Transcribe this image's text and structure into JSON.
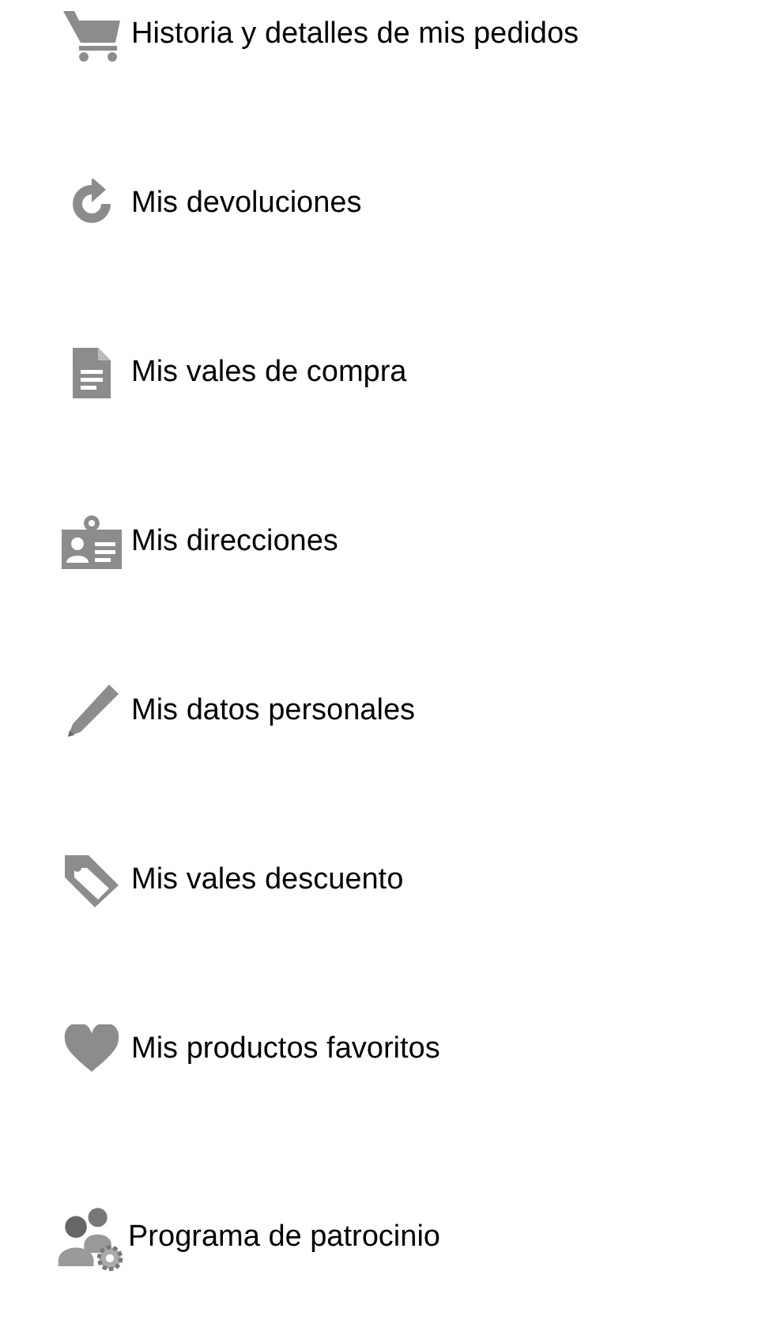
{
  "menu": [
    {
      "kind": "cart",
      "label": "Historia y detalles de mis pedidos"
    },
    {
      "kind": "returns",
      "label": "Mis devoluciones"
    },
    {
      "kind": "document",
      "label": "Mis vales de compra"
    },
    {
      "kind": "badge",
      "label": "Mis direcciones"
    },
    {
      "kind": "pencil",
      "label": "Mis datos personales"
    },
    {
      "kind": "tag",
      "label": "Mis vales descuento"
    },
    {
      "kind": "heart",
      "label": "Mis productos favoritos"
    },
    {
      "kind": "people",
      "label": "Programa de patrocinio"
    }
  ]
}
